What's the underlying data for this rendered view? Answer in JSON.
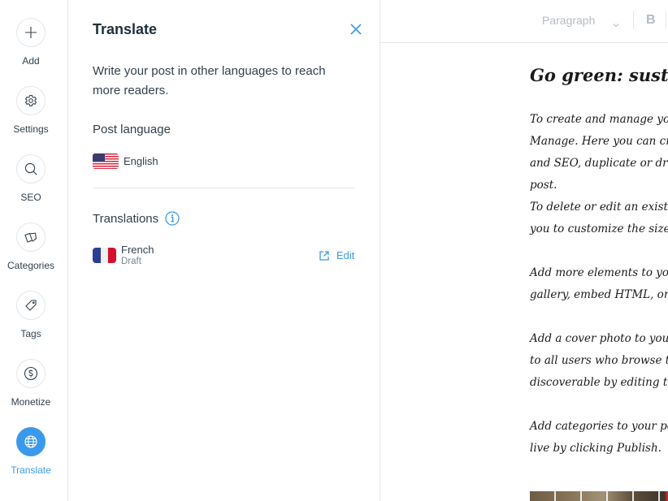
{
  "rail": {
    "items": [
      {
        "label": "Add",
        "icon": "plus-icon"
      },
      {
        "label": "Settings",
        "icon": "gear-icon"
      },
      {
        "label": "SEO",
        "icon": "search-icon"
      },
      {
        "label": "Categories",
        "icon": "cards-icon"
      },
      {
        "label": "Tags",
        "icon": "tag-icon"
      },
      {
        "label": "Monetize",
        "icon": "dollar-icon"
      },
      {
        "label": "Translate",
        "icon": "globe-icon",
        "active": true
      }
    ]
  },
  "panel": {
    "title": "Translate",
    "close_icon": "close-icon",
    "description": "Write your post in other languages to reach more readers.",
    "post_language_label": "Post language",
    "post_language": {
      "name": "English",
      "flag": "us-flag-icon"
    },
    "translations_label": "Translations",
    "translations": [
      {
        "name": "French",
        "status": "Draft",
        "flag": "france-flag-icon",
        "action": "Edit"
      }
    ]
  },
  "editor": {
    "toolbar": {
      "paragraph_select": "Paragraph",
      "bold_label": "B"
    },
    "post": {
      "title": "Go green: sustainable living tips",
      "lines": [
        "To create and manage your posts, go to",
        "Manage. Here you can create new posts, edit",
        "and SEO, duplicate or draft your",
        "post.",
        "To delete or edit an existing element, click on it. This will allow",
        "you to customize the size and position",
        "",
        "Add more elements to your post, such as an image",
        "gallery, embed HTML, or a video.",
        "",
        "Add a cover photo to your post. This image will be shown",
        "to all users who browse the blog. Make your post",
        "discoverable by editing the SEO settings.",
        "",
        "Add categories to your post and when you're ready, go",
        "live by clicking Publish."
      ]
    }
  },
  "colors": {
    "accent": "#3b99eb",
    "text": "#32404d",
    "muted": "#7a8795",
    "toolbar_disabled": "#b6bcc3"
  }
}
